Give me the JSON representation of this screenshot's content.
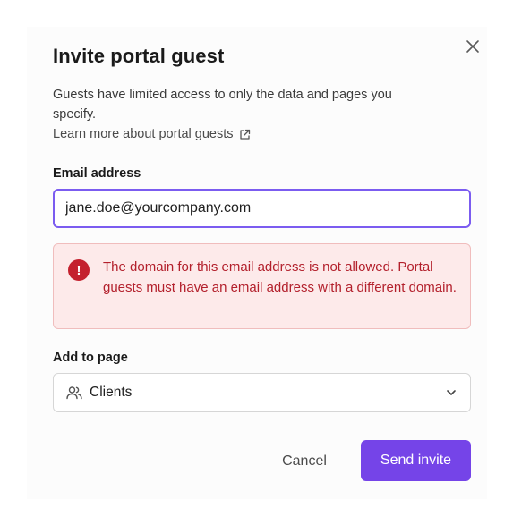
{
  "dialog": {
    "title": "Invite portal guest",
    "description": "Guests have limited access to only the data and pages you specify.",
    "learn_more_link": "Learn more about portal guests",
    "close_icon": "close-icon",
    "link_icon": "external-link-icon"
  },
  "email": {
    "label": "Email address",
    "value": "jane.doe@yourcompany.com"
  },
  "error": {
    "icon": "alert-circle-icon",
    "message": "The domain for this email address is not allowed. Portal guests must have an email address with a different domain."
  },
  "page_select": {
    "label": "Add to page",
    "icon": "people-icon",
    "selected": "Clients",
    "chevron": "chevron-down-icon"
  },
  "actions": {
    "cancel_label": "Cancel",
    "send_label": "Send invite"
  },
  "colors": {
    "accent": "#7544e8",
    "input_focus_border": "#7b5cf0",
    "error_text": "#b3202c",
    "error_bg": "#fdeaea",
    "error_icon_bg": "#c4212e"
  }
}
